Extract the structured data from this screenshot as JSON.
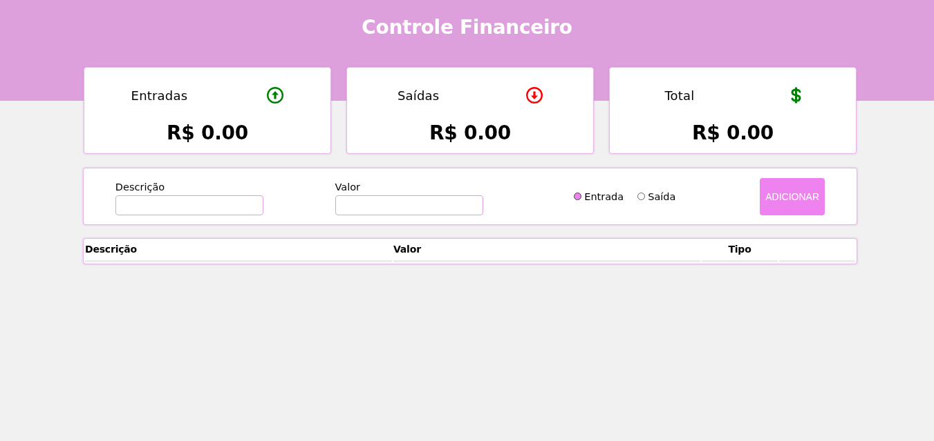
{
  "header": {
    "title": "Controle Financeiro"
  },
  "cards": [
    {
      "kind": "income",
      "label": "Entradas",
      "amount": "R$ 0.00"
    },
    {
      "kind": "expense",
      "label": "Saídas",
      "amount": "R$ 0.00"
    },
    {
      "kind": "total",
      "label": "Total",
      "amount": "R$ 0.00"
    }
  ],
  "form": {
    "fields": [
      {
        "label": "Descrição"
      },
      {
        "label": "Valor"
      }
    ],
    "options": [
      {
        "label": "Entrada",
        "selected": true
      },
      {
        "label": "Saída",
        "selected": false
      }
    ],
    "button": "ADICIONAR"
  },
  "table": {
    "columns": [
      "Descrição",
      "Valor",
      "Tipo"
    ]
  }
}
